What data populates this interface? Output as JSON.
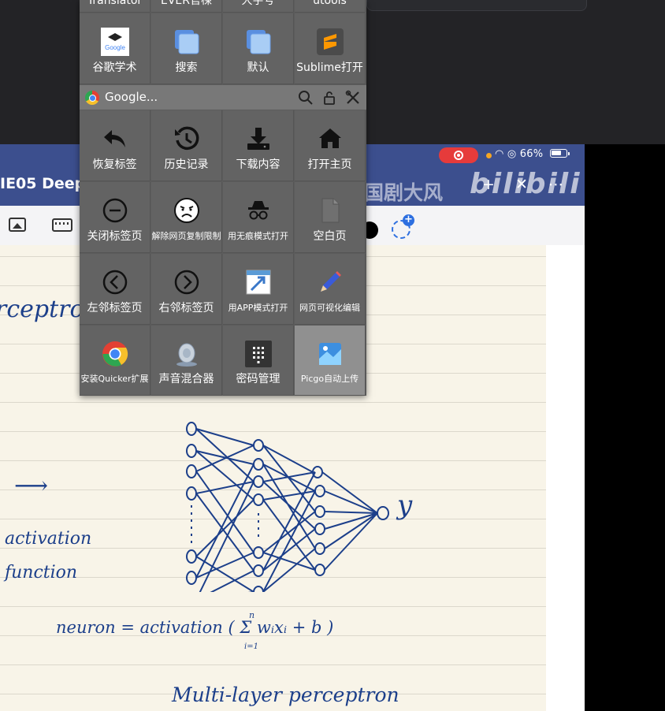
{
  "popup": {
    "top_row": [
      "Translator",
      "EVER官楝",
      "大字号",
      "utools"
    ],
    "rows": [
      [
        {
          "label": "谷歌学术",
          "icon": "google-scholar-icon"
        },
        {
          "label": "搜索",
          "icon": "copy-icon"
        },
        {
          "label": "默认",
          "icon": "copy-icon"
        },
        {
          "label": "Sublime打开",
          "icon": "sublime-icon"
        }
      ],
      [
        {
          "label": "恢复标签",
          "icon": "reply-icon"
        },
        {
          "label": "历史记录",
          "icon": "history-icon"
        },
        {
          "label": "下载内容",
          "icon": "download-icon"
        },
        {
          "label": "打开主页",
          "icon": "home-icon"
        }
      ],
      [
        {
          "label": "关闭标签页",
          "icon": "minus-circle-icon"
        },
        {
          "label": "解除网页复制限制",
          "icon": "angry-face-icon"
        },
        {
          "label": "用无痕模式打开",
          "icon": "incognito-icon"
        },
        {
          "label": "空白页",
          "icon": "blank-page-icon"
        }
      ],
      [
        {
          "label": "左邻标签页",
          "icon": "chevron-left-circle-icon"
        },
        {
          "label": "右邻标签页",
          "icon": "chevron-right-circle-icon"
        },
        {
          "label": "用APP模式打开",
          "icon": "open-app-icon"
        },
        {
          "label": "网页可视化编辑",
          "icon": "pencil-icon"
        }
      ],
      [
        {
          "label": "安装Quicker扩展",
          "icon": "chrome-icon"
        },
        {
          "label": "声音混合器",
          "icon": "speaker-icon"
        },
        {
          "label": "密码管理",
          "icon": "keypad-icon"
        },
        {
          "label": "Picgo自动上传",
          "icon": "picgo-icon"
        }
      ]
    ],
    "bar_label": "Google..."
  },
  "tablet": {
    "status_text": "66%",
    "doc_title": "IE05 Deep",
    "watermark": "国剧大风",
    "brand": "bilibili",
    "header_buttons": "+ ✕ ⋯"
  },
  "notes": {
    "perceptron": "rceptron",
    "activation": "activation",
    "function": "function",
    "arrow": "⟶",
    "formula": "neuron = activation ( Σ wᵢxᵢ + b )",
    "sum_top": "n",
    "sum_bottom": "i=1",
    "output": "y",
    "title": "Multi-layer perceptron"
  },
  "colors": {
    "ink": "#1c3f8a",
    "panel": "#636363",
    "highlight": "#909090",
    "header": "#3c4f8e"
  }
}
